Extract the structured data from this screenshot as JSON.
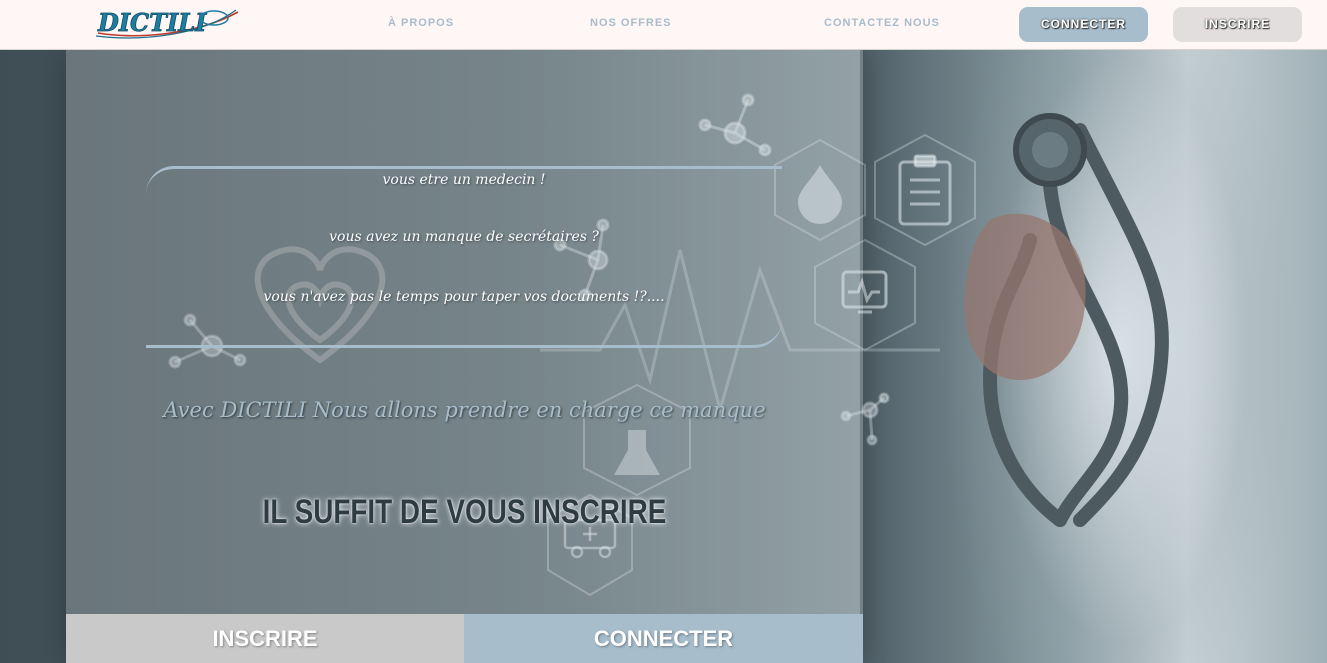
{
  "header": {
    "logo_text": "DICTILI",
    "nav": [
      {
        "label": "À PROPOS"
      },
      {
        "label": "NOS OFFRES"
      },
      {
        "label": "CONTACTEZ NOUS"
      }
    ],
    "connect_label": "CONNECTER",
    "signup_label": "INSCRIRE"
  },
  "hero": {
    "quote_lines": [
      "vous etre un medecin !",
      "vous avez un manque de secrétaires ?",
      "vous n'avez pas le temps pour taper vos documents !?...."
    ],
    "tagline": "Avec DICTILI Nous allons prendre en charge ce manque",
    "cta_title": "IL SUFFIT DE VOUS INSCRIRE",
    "signup_button": "INSCRIRE",
    "connect_button": "CONNECTER"
  },
  "colors": {
    "accent": "#a7bdcc",
    "header_bg": "#fff6f6",
    "signup_bg": "#c9c9c9",
    "dark_text": "#2d3b42"
  },
  "icons": [
    "stethoscope-icon",
    "heart-icon",
    "molecule-icon",
    "drop-icon",
    "clipboard-icon",
    "monitor-icon",
    "flask-icon",
    "ambulance-icon"
  ]
}
